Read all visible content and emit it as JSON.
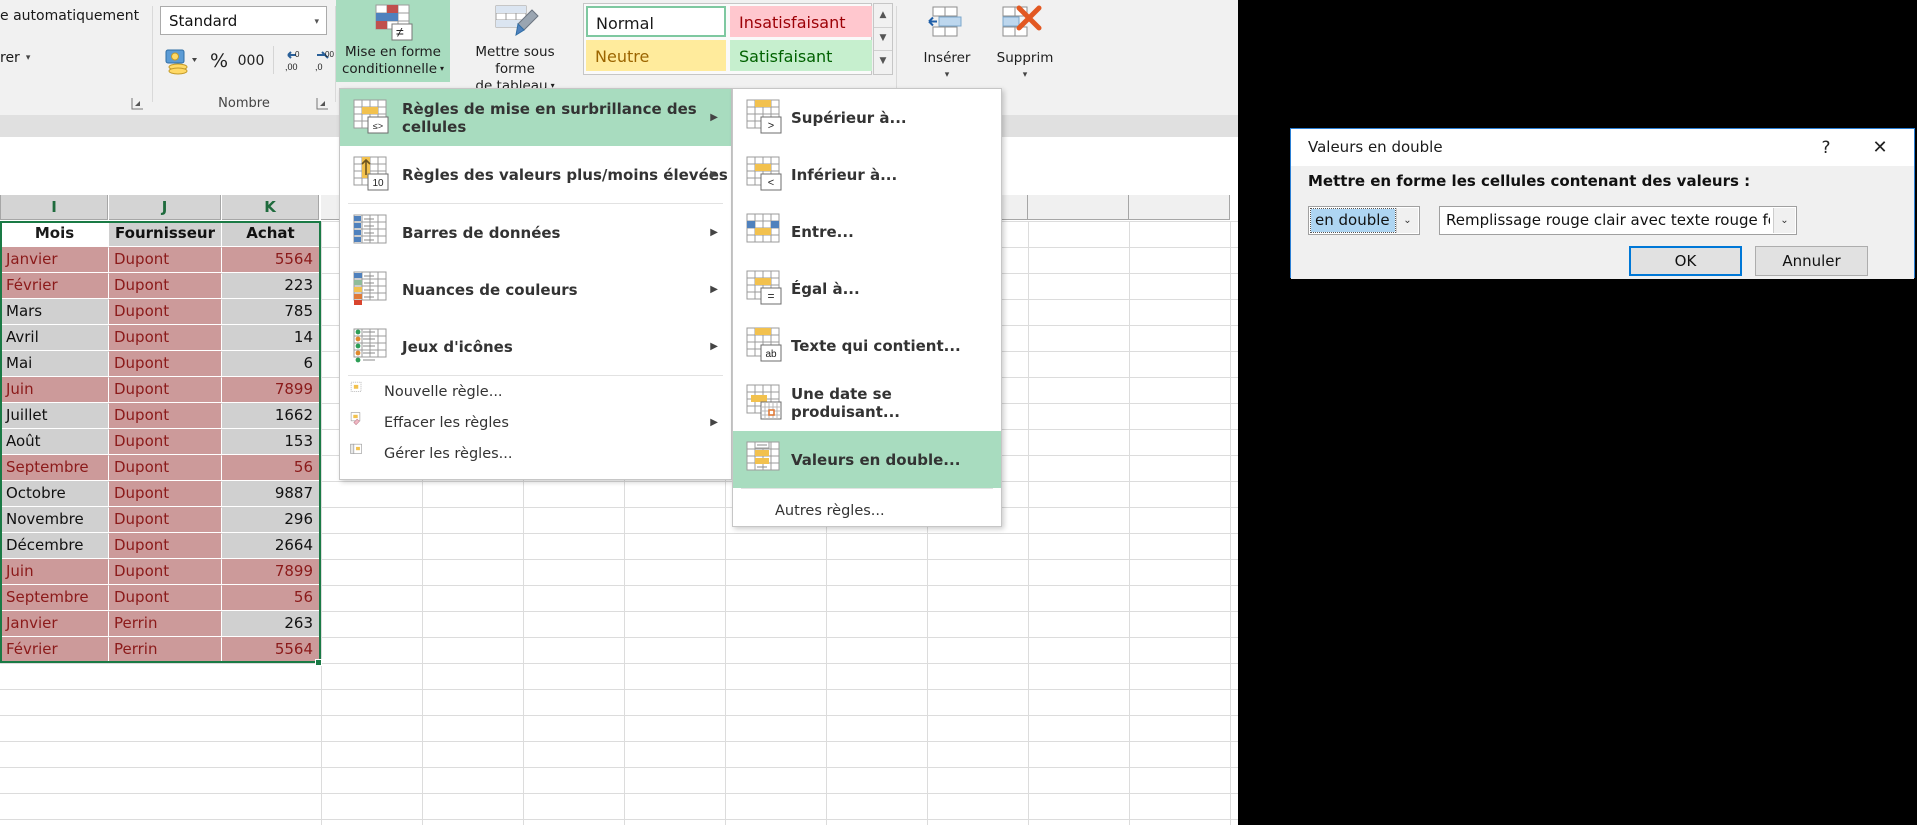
{
  "ribbon": {
    "alignment_group": {
      "wrap_text_label": "e automatiquement",
      "merge_label": "rer",
      "caret": "▾"
    },
    "number_group": {
      "group_label": "Nombre",
      "format_value": "Standard",
      "format_caret": "▾",
      "percent_label": "%",
      "thousands_label": "000",
      "money_icon": "currency-icon",
      "increase_decimal_icon": "increase-decimal-icon",
      "decrease_decimal_icon": "decrease-decimal-icon",
      "dialog_launcher_icon": "dialog-launcher-icon"
    },
    "styles_group": {
      "conditional_formatting_label_line1": "Mise en forme",
      "conditional_formatting_label_line2": "conditionnelle",
      "format_as_table_label_line1": "Mettre sous forme",
      "format_as_table_label_line2": "de tableau",
      "caret": "▾",
      "cell_styles": [
        {
          "name": "Normal",
          "bg": "#ffffff",
          "fg": "#111111"
        },
        {
          "name": "Insatisfaisant",
          "bg": "#ffc7ce",
          "fg": "#9c0006"
        },
        {
          "name": "Neutre",
          "bg": "#ffeb9c",
          "fg": "#9c6500"
        },
        {
          "name": "Satisfaisant",
          "bg": "#c6efce",
          "fg": "#006100"
        }
      ],
      "gallery_scroll": [
        "▲",
        "▼",
        "▼"
      ]
    },
    "cells_group": {
      "insert_label": "Insérer",
      "delete_label": "Supprim",
      "caret": "▾"
    }
  },
  "cf_menu": {
    "items": [
      {
        "label": "Règles de mise en surbrillance des cellules",
        "icon": "highlight-cells-rules-icon",
        "arrow": "▶",
        "selected": true
      },
      {
        "label": "Règles des valeurs plus/moins élevées",
        "icon": "top-bottom-rules-icon",
        "arrow": "▶",
        "selected": false
      },
      {
        "label": "Barres de données",
        "icon": "data-bars-icon",
        "arrow": "▶",
        "selected": false
      },
      {
        "label": "Nuances de couleurs",
        "icon": "color-scales-icon",
        "arrow": "▶",
        "selected": false
      },
      {
        "label": "Jeux d'icônes",
        "icon": "icon-sets-icon",
        "arrow": "▶",
        "selected": false
      }
    ],
    "small_items": [
      {
        "label": "Nouvelle règle...",
        "icon": "new-rule-icon",
        "arrow": ""
      },
      {
        "label": "Effacer les règles",
        "icon": "clear-rules-icon",
        "arrow": "▶"
      },
      {
        "label": "Gérer les règles...",
        "icon": "manage-rules-icon",
        "arrow": ""
      }
    ]
  },
  "sub_menu": {
    "items": [
      {
        "label": "Supérieur à...",
        "icon": "greater-than-icon",
        "selected": false
      },
      {
        "label": "Inférieur à...",
        "icon": "less-than-icon",
        "selected": false
      },
      {
        "label": "Entre...",
        "icon": "between-icon",
        "selected": false
      },
      {
        "label": "Égal à...",
        "icon": "equal-to-icon",
        "selected": false
      },
      {
        "label": "Texte qui contient...",
        "icon": "text-contains-icon",
        "selected": false
      },
      {
        "label": "Une date se produisant...",
        "icon": "date-occurring-icon",
        "selected": false
      },
      {
        "label": "Valeurs en double...",
        "icon": "duplicate-values-icon",
        "selected": true
      }
    ],
    "other_rules_label": "Autres règles..."
  },
  "sheet": {
    "column_headers": [
      "I",
      "J",
      "K"
    ],
    "table_headers": [
      "Mois",
      "Fournisseur",
      "Achat"
    ],
    "rows": [
      {
        "mois": "Janvier",
        "fournisseur": "Dupont",
        "achat": "5564",
        "mois_dup": true,
        "four_dup": true,
        "achat_dup": true
      },
      {
        "mois": "Février",
        "fournisseur": "Dupont",
        "achat": "223",
        "mois_dup": true,
        "four_dup": true,
        "achat_dup": false
      },
      {
        "mois": "Mars",
        "fournisseur": "Dupont",
        "achat": "785",
        "mois_dup": false,
        "four_dup": true,
        "achat_dup": false
      },
      {
        "mois": "Avril",
        "fournisseur": "Dupont",
        "achat": "14",
        "mois_dup": false,
        "four_dup": true,
        "achat_dup": false
      },
      {
        "mois": "Mai",
        "fournisseur": "Dupont",
        "achat": "6",
        "mois_dup": false,
        "four_dup": true,
        "achat_dup": false
      },
      {
        "mois": "Juin",
        "fournisseur": "Dupont",
        "achat": "7899",
        "mois_dup": true,
        "four_dup": true,
        "achat_dup": true
      },
      {
        "mois": "Juillet",
        "fournisseur": "Dupont",
        "achat": "1662",
        "mois_dup": false,
        "four_dup": true,
        "achat_dup": false
      },
      {
        "mois": "Août",
        "fournisseur": "Dupont",
        "achat": "153",
        "mois_dup": false,
        "four_dup": true,
        "achat_dup": false
      },
      {
        "mois": "Septembre",
        "fournisseur": "Dupont",
        "achat": "56",
        "mois_dup": true,
        "four_dup": true,
        "achat_dup": true
      },
      {
        "mois": "Octobre",
        "fournisseur": "Dupont",
        "achat": "9887",
        "mois_dup": false,
        "four_dup": true,
        "achat_dup": false
      },
      {
        "mois": "Novembre",
        "fournisseur": "Dupont",
        "achat": "296",
        "mois_dup": false,
        "four_dup": true,
        "achat_dup": false
      },
      {
        "mois": "Décembre",
        "fournisseur": "Dupont",
        "achat": "2664",
        "mois_dup": false,
        "four_dup": true,
        "achat_dup": false
      },
      {
        "mois": "Juin",
        "fournisseur": "Dupont",
        "achat": "7899",
        "mois_dup": true,
        "four_dup": true,
        "achat_dup": true
      },
      {
        "mois": "Septembre",
        "fournisseur": "Dupont",
        "achat": "56",
        "mois_dup": true,
        "four_dup": true,
        "achat_dup": true
      },
      {
        "mois": "Janvier",
        "fournisseur": "Perrin",
        "achat": "263",
        "mois_dup": true,
        "four_dup": true,
        "achat_dup": false
      },
      {
        "mois": "Février",
        "fournisseur": "Perrin",
        "achat": "5564",
        "mois_dup": true,
        "four_dup": true,
        "achat_dup": true
      }
    ],
    "colors": {
      "duplicate_fill": "#cc9a9a",
      "duplicate_text": "#8b1a1a",
      "selection_fill": "#d0d0d0",
      "selection_border": "#1a7a45"
    }
  },
  "dialog": {
    "title": "Valeurs en double",
    "help_icon": "?",
    "close_icon": "✕",
    "prompt": "Mettre en forme les cellules contenant des valeurs :",
    "combo1_value": "en double",
    "combo2_value": "Remplissage rouge clair avec texte rouge foncé",
    "combo_caret": "⌄",
    "ok_label": "OK",
    "cancel_label": "Annuler",
    "accent": "#0078d7"
  }
}
